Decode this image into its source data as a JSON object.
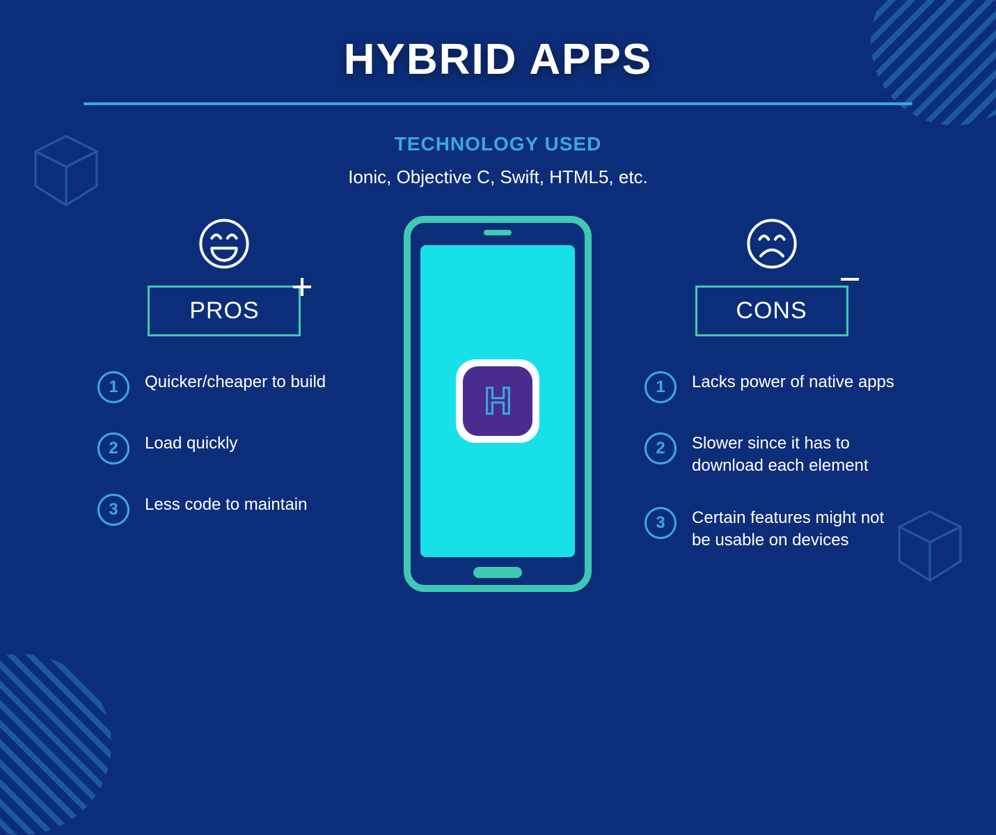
{
  "title": "HYBRID APPS",
  "tech_heading": "TECHNOLOGY USED",
  "tech_body": "Ionic, Objective C, Swift, HTML5, etc.",
  "pros": {
    "label": "PROS",
    "items": [
      {
        "n": "1",
        "text": "Quicker/cheaper to build"
      },
      {
        "n": "2",
        "text": "Load quickly"
      },
      {
        "n": "3",
        "text": "Less code to maintain"
      }
    ]
  },
  "cons": {
    "label": "CONS",
    "items": [
      {
        "n": "1",
        "text": "Lacks power of native apps"
      },
      {
        "n": "2",
        "text": "Slower since it has to download each element"
      },
      {
        "n": "3",
        "text": "Certain features might not be usable on devices"
      }
    ]
  },
  "app_letter": "H",
  "colors": {
    "background": "#0c2e7a",
    "accent_blue": "#3ba8e0",
    "accent_teal": "#3fc9b3",
    "screen_cyan": "#17e0e8",
    "icon_purple": "#4a2c8f"
  }
}
